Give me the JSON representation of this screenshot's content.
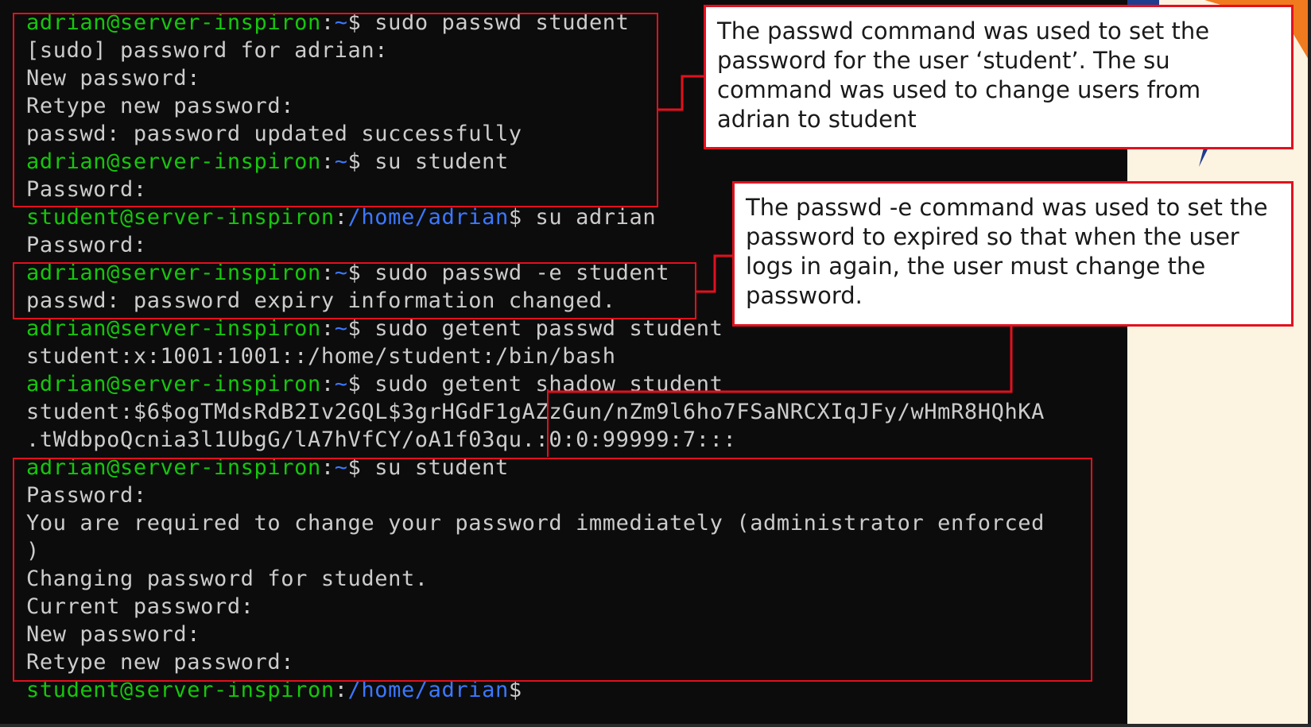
{
  "terminal": {
    "lines": [
      {
        "user": "adrian@server-inspiron",
        "path": "~",
        "cmd": " sudo passwd student"
      },
      {
        "text": "[sudo] password for adrian:"
      },
      {
        "text": "New password:"
      },
      {
        "text": "Retype new password:"
      },
      {
        "text": "passwd: password updated successfully"
      },
      {
        "user": "adrian@server-inspiron",
        "path": "~",
        "cmd": " su student"
      },
      {
        "text": "Password:"
      },
      {
        "user": "student@server-inspiron",
        "path": "/home/adrian",
        "cmd": " su adrian"
      },
      {
        "text": "Password:"
      },
      {
        "user": "adrian@server-inspiron",
        "path": "~",
        "cmd": " sudo passwd -e student"
      },
      {
        "text": "passwd: password expiry information changed."
      },
      {
        "user": "adrian@server-inspiron",
        "path": "~",
        "cmd": " sudo getent passwd student"
      },
      {
        "text": "student:x:1001:1001::/home/student:/bin/bash"
      },
      {
        "user": "adrian@server-inspiron",
        "path": "~",
        "cmd": " sudo getent shadow student"
      },
      {
        "text": "student:$6$ogTMdsRdB2Iv2GQL$3grHGdF1gAZzGun/nZm9l6ho7FSaNRCXIqJFy/wHmR8HQhKA"
      },
      {
        "text": ".tWdbpoQcnia3l1UbgG/lA7hVfCY/oA1f03qu.:0:0:99999:7:::"
      },
      {
        "user": "adrian@server-inspiron",
        "path": "~",
        "cmd": " su student"
      },
      {
        "text": "Password:"
      },
      {
        "text": "You are required to change your password immediately (administrator enforced"
      },
      {
        "text": ")"
      },
      {
        "text": "Changing password for student."
      },
      {
        "text": "Current password:"
      },
      {
        "text": "New password:"
      },
      {
        "text": "Retype new password:"
      },
      {
        "user": "student@server-inspiron",
        "path": "/home/adrian",
        "cmd": ""
      }
    ]
  },
  "callouts": {
    "passwd_su": "The passwd command was used to set the password for the user ‘student’. The su command was used to change users from adrian to student",
    "passwd_expire": "The passwd -e command was used to set the password to expired so that when the user logs in again, the user must change the password."
  },
  "colors": {
    "terminal_bg": "#0c0c0c",
    "terminal_text": "#cccccc",
    "prompt_user": "#16c60c",
    "prompt_path": "#3b78ff",
    "annotation_red": "#e3101e"
  }
}
